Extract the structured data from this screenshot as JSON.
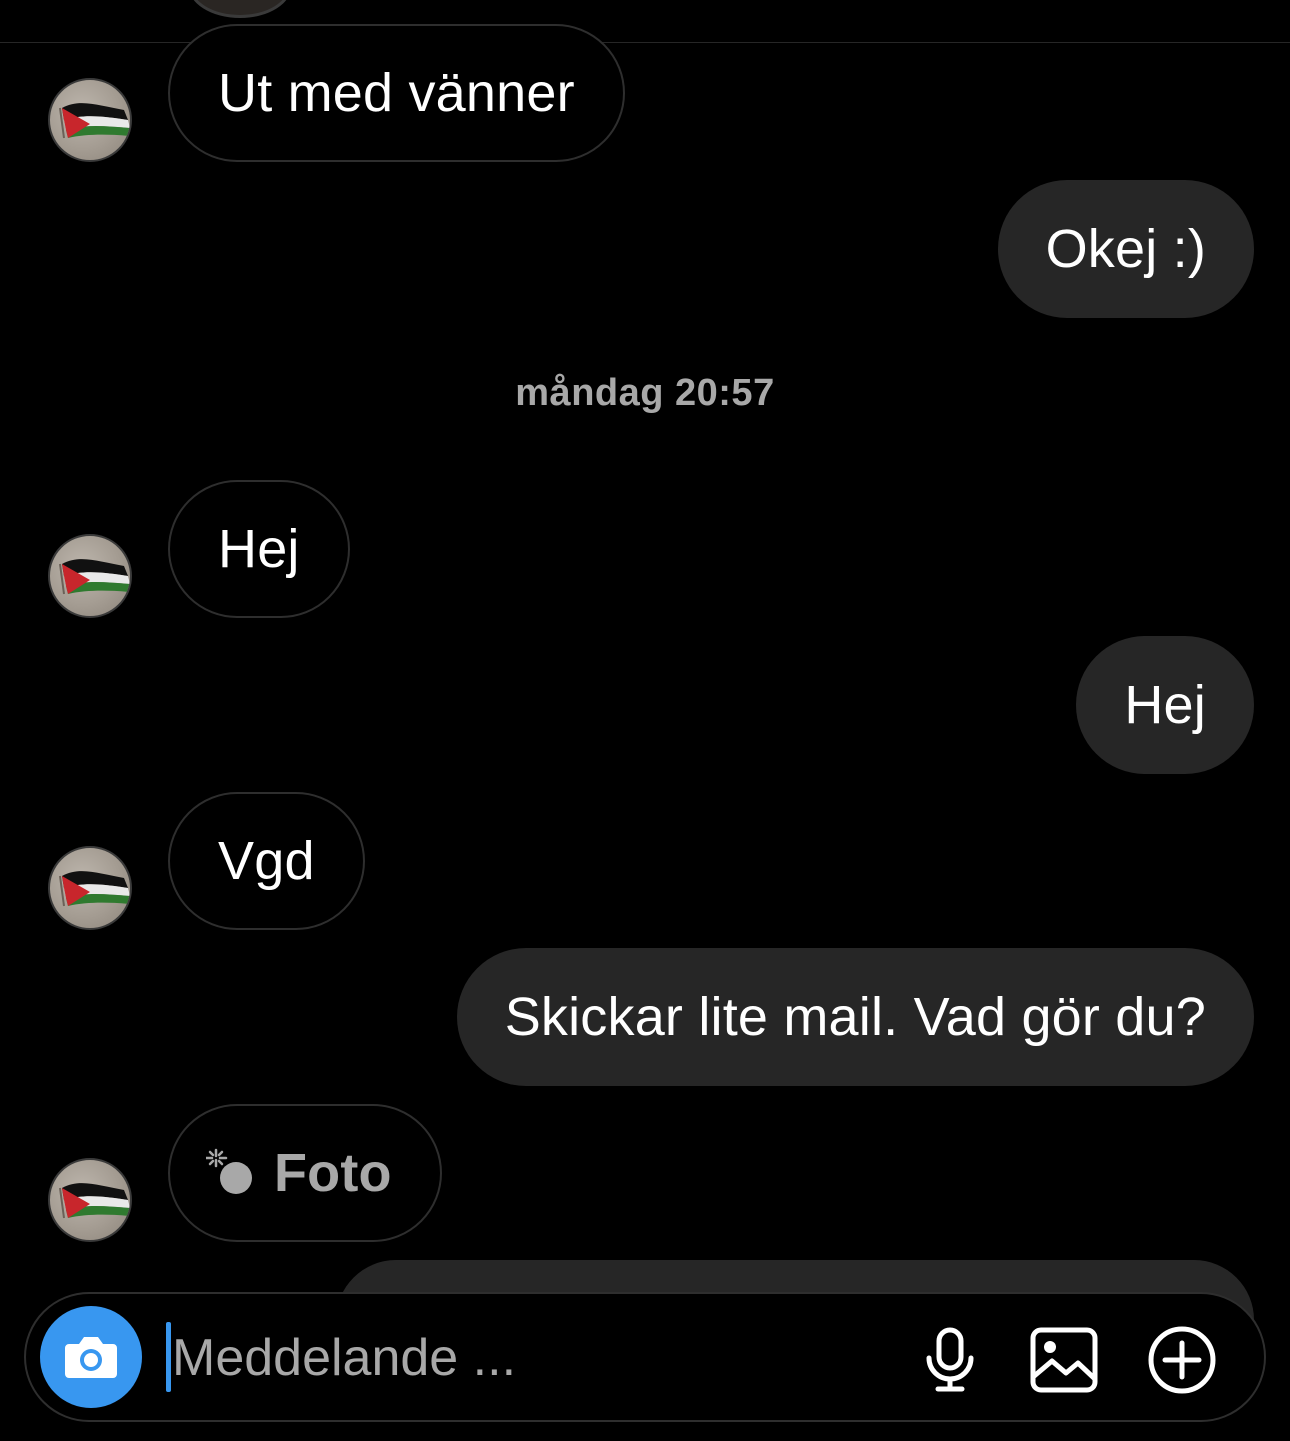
{
  "thread": {
    "timestamp": "måndag 20:57",
    "messages": [
      {
        "direction": "incoming",
        "text": "Ut med vänner"
      },
      {
        "direction": "outgoing",
        "text": "Okej :)"
      },
      {
        "direction": "incoming",
        "text": "Hej"
      },
      {
        "direction": "outgoing",
        "text": "Hej"
      },
      {
        "direction": "incoming",
        "text": "Vgd"
      },
      {
        "direction": "outgoing",
        "text": "Skickar lite mail. Vad gör du?"
      },
      {
        "direction": "incoming",
        "type": "photo",
        "text": "Foto"
      }
    ]
  },
  "composer": {
    "placeholder": "Meddelande ...",
    "icons": [
      "camera-icon",
      "microphone-icon",
      "gallery-icon",
      "add-icon"
    ]
  },
  "colors": {
    "background": "#000000",
    "outgoing_bubble": "#262626",
    "incoming_border": "#2e2e2e",
    "accent": "#3897f0",
    "muted_text": "#a8a8a8"
  }
}
